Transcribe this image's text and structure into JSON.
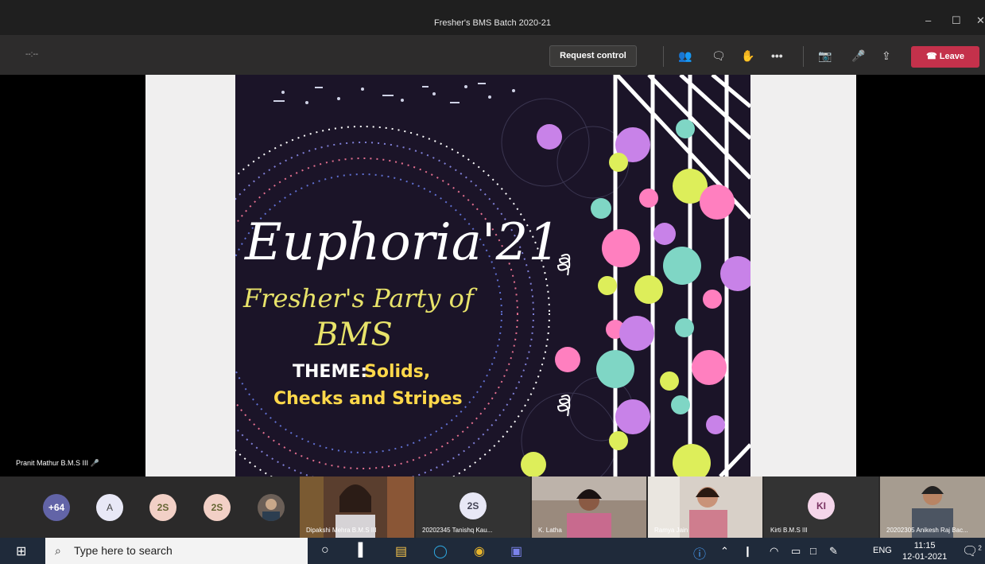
{
  "window": {
    "title": "Fresher's BMS Batch 2020-21",
    "minimize": "–",
    "maximize": "☐",
    "close": "✕"
  },
  "toolbar": {
    "timer": "--:--",
    "request_control": "Request control",
    "leave": "Leave"
  },
  "slide": {
    "title": "Euphoria'21",
    "subtitle_line1": "Fresher's Party of",
    "subtitle_line2": "BMS",
    "theme_label": "THEME:",
    "theme_value": "Solids,",
    "theme_line2": "Checks and Stripes"
  },
  "presenter": {
    "name": "Pranit Mathur B.M.S III"
  },
  "participants": {
    "overflow": "+64",
    "avatars": [
      "A",
      "2S",
      "2S"
    ],
    "tiles": [
      {
        "name": "Dipakshi Mehra B.M.S III"
      },
      {
        "initials": "2S",
        "name": "20202345 Tanishq Kau..."
      },
      {
        "name": "K. Latha"
      },
      {
        "name": "Ramya Jain"
      },
      {
        "initials": "KI",
        "name": "Kirti B.M.S III"
      },
      {
        "name": "20202305 Anikesh Raj Bac..."
      }
    ]
  },
  "taskbar": {
    "search_placeholder": "Type here to search",
    "language": "ENG",
    "time": "11:15",
    "date": "12-01-2021",
    "notification_count": "2"
  }
}
